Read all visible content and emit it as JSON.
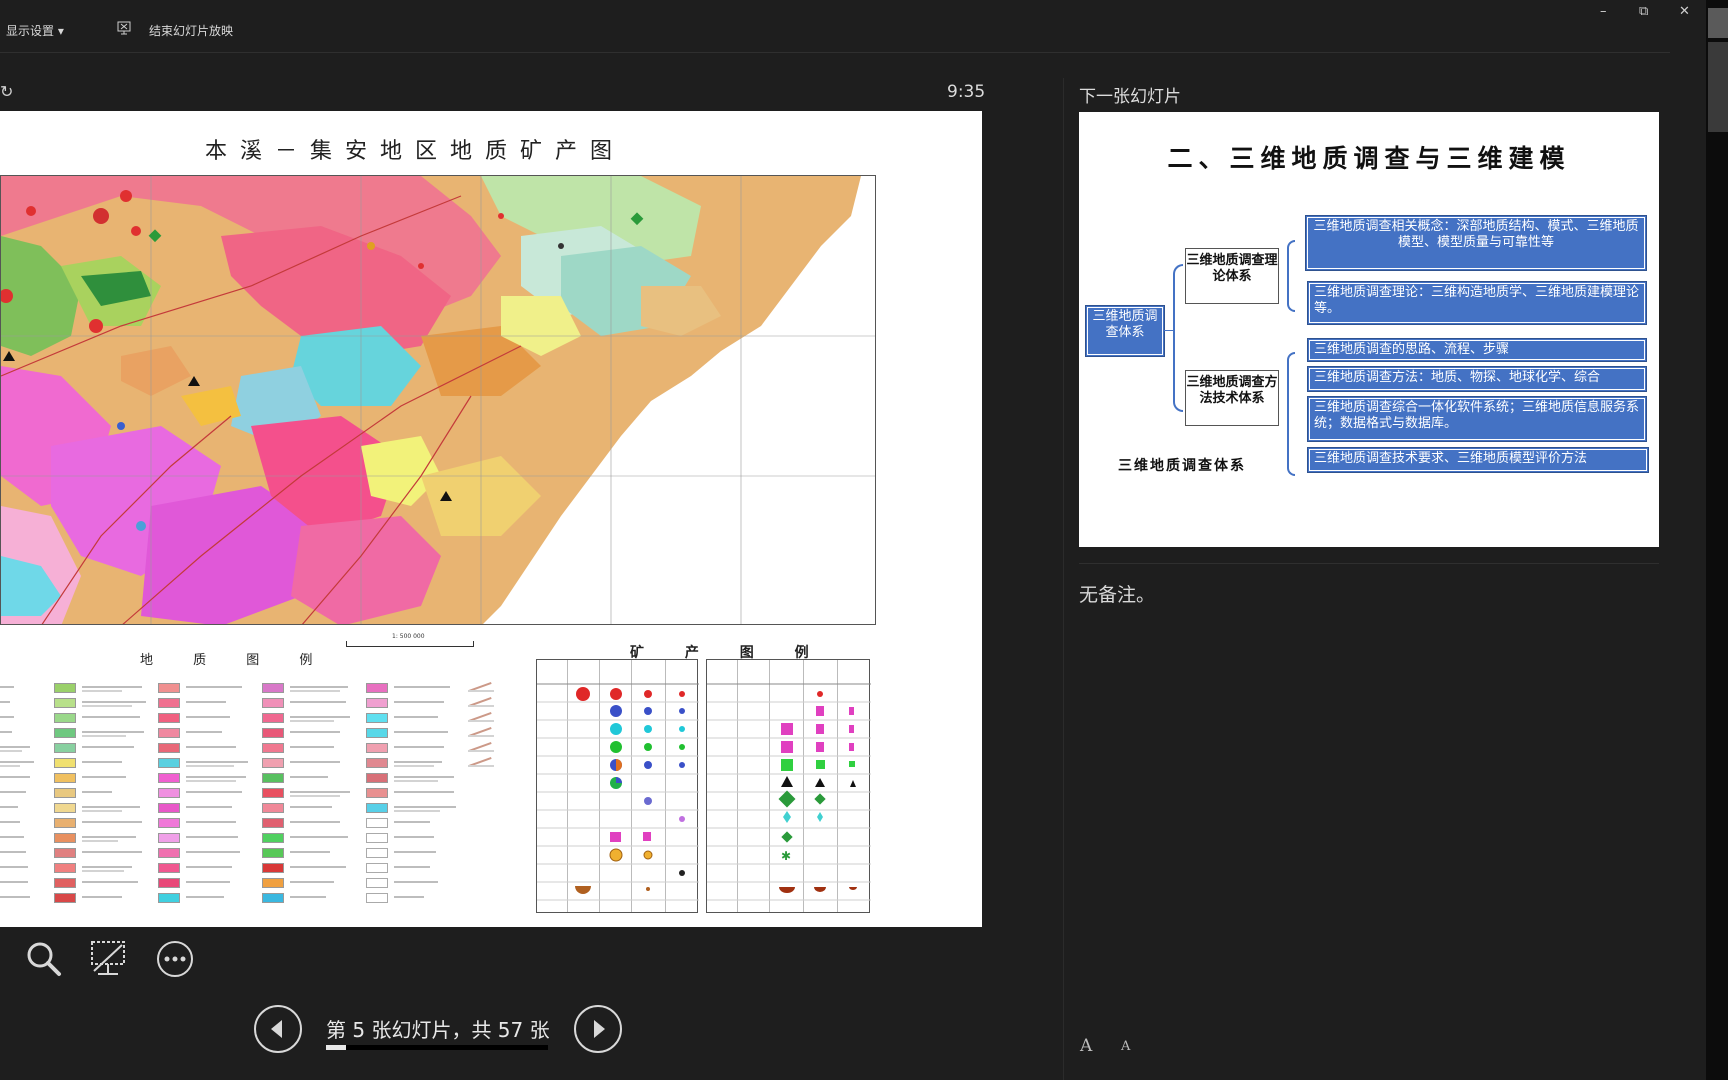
{
  "toolbar": {
    "display_settings": "显示设置 ▾",
    "end_show": "结束幻灯片放映"
  },
  "window_controls": {
    "minimize": "–",
    "restore": "⧉",
    "close": "✕"
  },
  "presenter": {
    "timer": "9:35",
    "slide_counter": "第 5 张幻灯片，共 57 张",
    "progress": 0.088,
    "current_slide": {
      "title": "本溪－集安地区地质矿产图",
      "geology_legend_title": "地 质 图 例",
      "mineral_legend_title": "矿 产 图 例",
      "scale": "1: 500 000"
    },
    "next_slide_label": "下一张幻灯片",
    "notes": "无备注。"
  },
  "next_slide": {
    "title": "二、三维地质调查与三维建模",
    "root": "三维地质调查体系",
    "branch_theory": "三维地质调查理论体系",
    "branch_method": "三维地质调查方法技术体系",
    "items": [
      "三维地质调查相关概念：深部地质结构、模式、三维地质模型、模型质量与可靠性等",
      "三维地质调查理论：三维构造地质学、三维地质建模理论等。",
      "三维地质调查的思路、流程、步骤",
      "三维地质调查方法：地质、物探、地球化学、综合",
      "三维地质调查综合一体化软件系统；三维地质信息服务系统；数据格式与数据库。",
      "三维地质调查技术要求、三维地质模型评价方法"
    ],
    "caption": "三维地质调查体系"
  },
  "icons": {
    "refresh": "↻",
    "font_up": "A",
    "font_down": "A"
  },
  "colors": {
    "background": "#1e1e1e",
    "slide_blue": "#4472c4"
  }
}
